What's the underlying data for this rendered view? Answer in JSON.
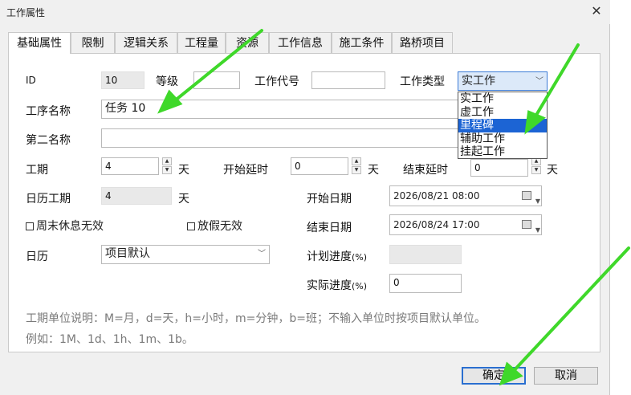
{
  "window": {
    "title": "工作属性",
    "close_glyph": "✕"
  },
  "tabs": [
    {
      "label": "基础属性",
      "active": true
    },
    {
      "label": "限制"
    },
    {
      "label": "逻辑关系"
    },
    {
      "label": "工程量"
    },
    {
      "label": "资源"
    },
    {
      "label": "工作信息"
    },
    {
      "label": "施工条件"
    },
    {
      "label": "路桥项目"
    }
  ],
  "fields": {
    "id_label": "ID",
    "id_value": "10",
    "grade_label": "等级",
    "grade_value": "",
    "code_label": "工作代号",
    "code_value": "",
    "type_label": "工作类型",
    "type_value": "实工作",
    "type_options": [
      "实工作",
      "虚工作",
      "里程碑",
      "辅助工作",
      "挂起工作"
    ],
    "type_highlighted": "里程碑",
    "name_label": "工序名称",
    "name_value": "任务 10",
    "second_name_label": "第二名称",
    "second_name_value": "",
    "duration_label": "工期",
    "duration_value": "4",
    "duration_unit": "天",
    "start_delay_label": "开始延时",
    "start_delay_value": "0",
    "start_delay_unit": "天",
    "end_delay_label": "结束延时",
    "end_delay_value": "0",
    "end_delay_unit": "天",
    "cal_duration_label": "日历工期",
    "cal_duration_value": "4",
    "cal_duration_unit": "天",
    "start_date_label": "开始日期",
    "start_date_value": "2026/08/21 08:00",
    "end_date_label": "结束日期",
    "end_date_value": "2026/08/24 17:00",
    "weekend_label": "周末休息无效",
    "holiday_label": "放假无效",
    "calendar_label": "日历",
    "calendar_value": "项目默认",
    "plan_progress_label": "计划进度",
    "plan_progress_unit": "(%)",
    "plan_progress_value": "",
    "actual_progress_label": "实际进度",
    "actual_progress_unit": "(%)",
    "actual_progress_value": "0"
  },
  "notes": {
    "line1": "工期单位说明：M=月，d=天，h=小时，m=分钟，b=班；不输入单位时按项目默认单位。",
    "line2": "例如：1M、1d、1h、1m、1b。"
  },
  "buttons": {
    "ok": "确定",
    "cancel": "取消"
  },
  "colors": {
    "arrow": "#3fd82a",
    "accent": "#1c64d4"
  }
}
